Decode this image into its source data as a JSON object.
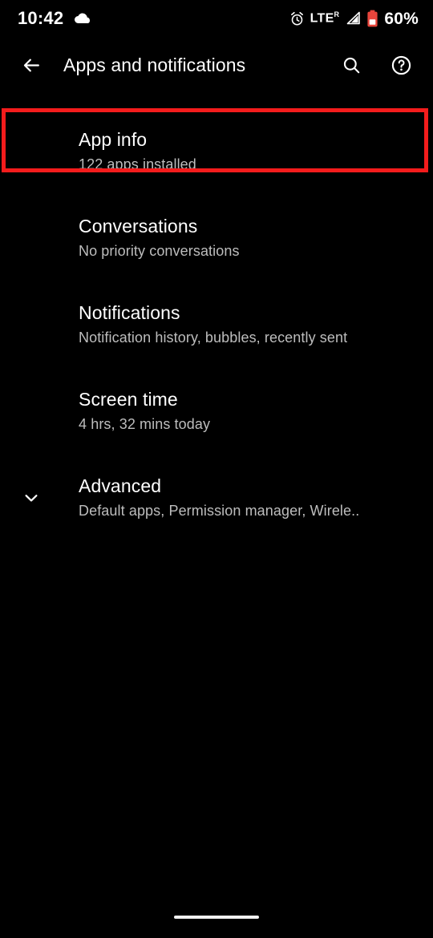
{
  "status_bar": {
    "clock": "10:42",
    "weather_icon": "cloud-icon",
    "alarm_icon": "alarm-clock-icon",
    "network_type": "LTE",
    "network_roaming": "R",
    "signal_icon": "signal-bars-icon",
    "battery_icon": "battery-low-icon",
    "battery_percent": "60%",
    "battery_color": "#e8453c"
  },
  "app_bar": {
    "back_icon": "back-arrow-icon",
    "title": "Apps and notifications",
    "search_icon": "search-icon",
    "help_icon": "help-circle-icon"
  },
  "list": {
    "items": [
      {
        "title": "App info",
        "subtitle": "122 apps installed",
        "has_chevron": false,
        "highlighted": true
      },
      {
        "title": "Conversations",
        "subtitle": "No priority conversations",
        "has_chevron": false,
        "highlighted": false
      },
      {
        "title": "Notifications",
        "subtitle": "Notification history, bubbles, recently sent",
        "has_chevron": false,
        "highlighted": false
      },
      {
        "title": "Screen time",
        "subtitle": "4 hrs, 32 mins today",
        "has_chevron": false,
        "highlighted": false
      },
      {
        "title": "Advanced",
        "subtitle": "Default apps, Permission manager, Wirele..",
        "has_chevron": true,
        "chevron_icon": "chevron-down-icon",
        "highlighted": false
      }
    ]
  },
  "annotation": {
    "highlight_color": "#f41c1c",
    "target": "App info"
  },
  "nav_bar": {
    "home_indicator": "home-gesture-bar"
  },
  "theme": {
    "background": "#000000",
    "title_text": "#ffffff",
    "subtitle_text": "#bdbdbd"
  }
}
